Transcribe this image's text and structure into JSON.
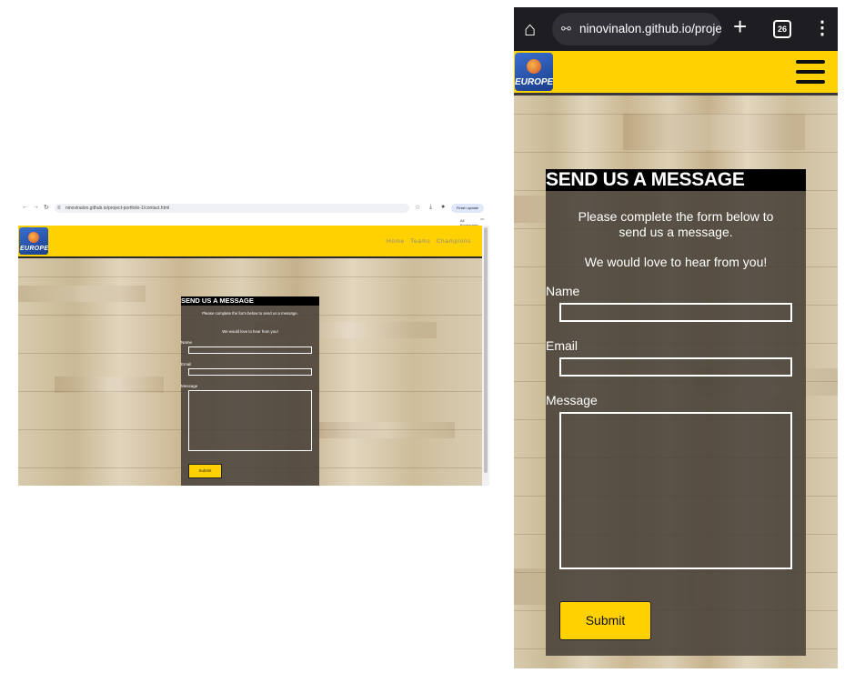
{
  "desktop": {
    "browser": {
      "url": "ninovinalon.github.io/project-portfolio-1/contact.html",
      "update_label": "Finish update",
      "bookmarks_label": "All Bookmarks"
    },
    "header": {
      "logo_text": "EUROPE",
      "nav": [
        "Home",
        "Teams",
        "Champions"
      ]
    },
    "form": {
      "title": "SEND US A MESSAGE",
      "intro": "Please complete the form below to send us a message.",
      "subintro": "We would love to hear from you!",
      "name_label": "Name",
      "email_label": "Email",
      "message_label": "Message",
      "submit_label": "Submit"
    }
  },
  "mobile": {
    "browser": {
      "url": "ninovinalon.github.io/projec",
      "tab_count": "26"
    },
    "header": {
      "logo_text": "EUROPE"
    },
    "form": {
      "title": "SEND US A MESSAGE",
      "intro": "Please complete the form below to send us a message.",
      "subintro": "We would love to hear from you!",
      "name_label": "Name",
      "email_label": "Email",
      "message_label": "Message",
      "submit_label": "Submit"
    }
  },
  "colors": {
    "accent": "#ffd100",
    "card": "#48403a",
    "title_bar": "#000000"
  }
}
